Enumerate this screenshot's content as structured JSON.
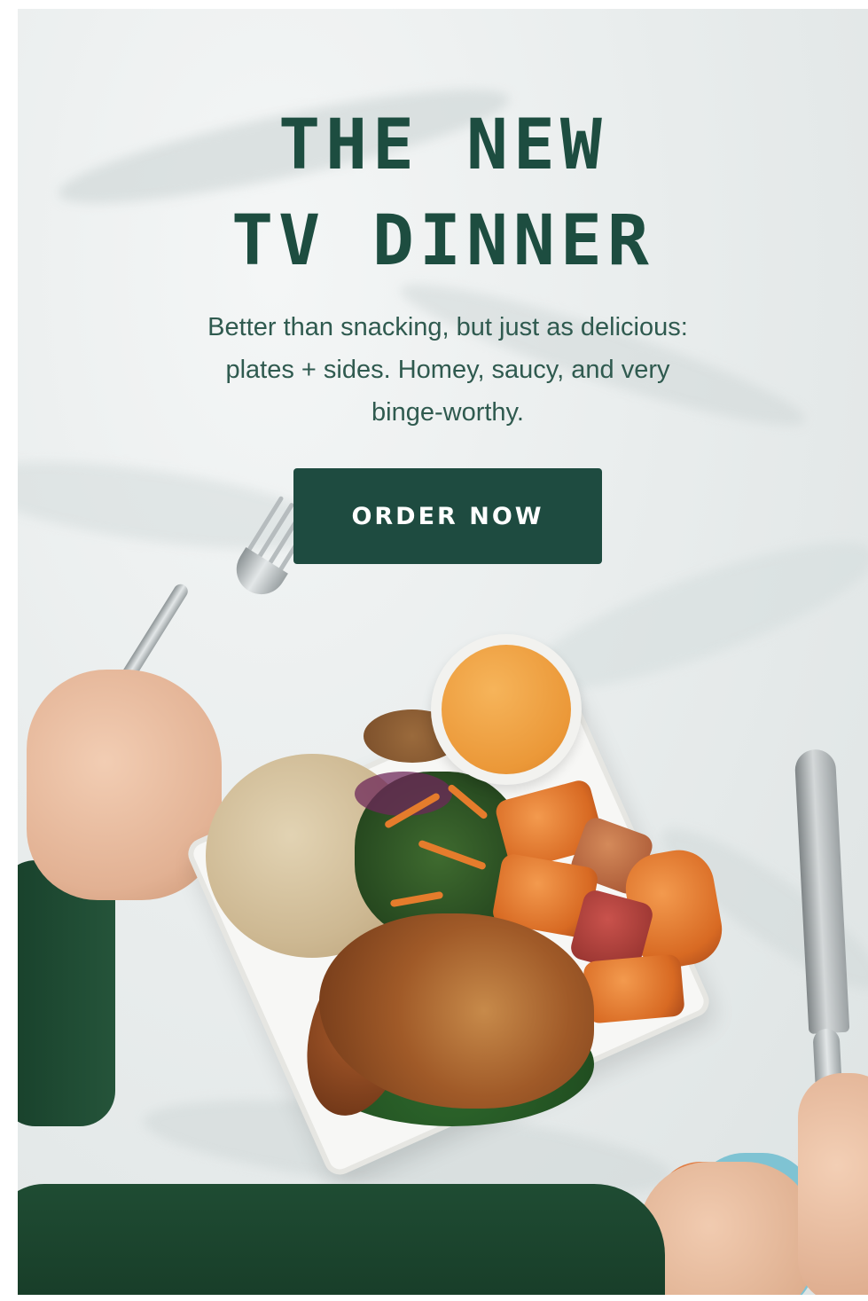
{
  "hero": {
    "headline_line1": "THE NEW",
    "headline_line2": "TV DINNER",
    "subtext_line1": "Better than snacking, but just as delicious:",
    "subtext_line2": "plates + sides. Homey, saucy, and very",
    "subtext_line3": "binge-worthy.",
    "cta_label": "ORDER NOW"
  },
  "colors": {
    "brand_green": "#1e4b40",
    "headline_green": "#1d4d40",
    "background": "#eceff0"
  }
}
